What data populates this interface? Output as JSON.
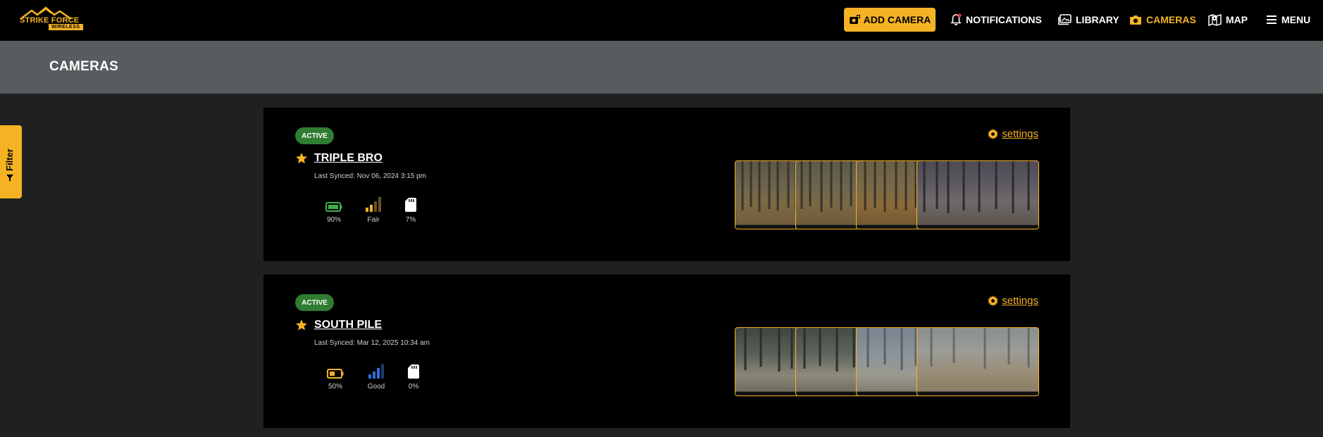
{
  "brand": {
    "name": "STRIKE FORCE",
    "sub": "WIRELESS"
  },
  "nav": {
    "add_camera": "ADD CAMERA",
    "notifications": "NOTIFICATIONS",
    "library": "LIBRARY",
    "cameras": "CAMERAS",
    "map": "MAP",
    "menu": "MENU"
  },
  "page": {
    "title": "CAMERAS"
  },
  "filter": {
    "label": "Filter"
  },
  "colors": {
    "accent": "#f5b324",
    "active_badge": "#2f7d32",
    "header_band": "#575d5f"
  },
  "cameras": [
    {
      "status": "ACTIVE",
      "name": "TRIPLE BRO",
      "last_synced": "Last Synced: Nov 06, 2024 3:15 pm",
      "battery": "90%",
      "signal": "Fair",
      "storage": "7%",
      "settings_label": "settings",
      "battery_icon": "battery-full-icon",
      "signal_icon": "signal-fair-icon"
    },
    {
      "status": "ACTIVE",
      "name": "SOUTH PILE",
      "last_synced": "Last Synced: Mar 12, 2025 10:34 am",
      "battery": "50%",
      "signal": "Good",
      "storage": "0%",
      "settings_label": "settings",
      "battery_icon": "battery-half-icon",
      "signal_icon": "signal-good-icon"
    }
  ]
}
